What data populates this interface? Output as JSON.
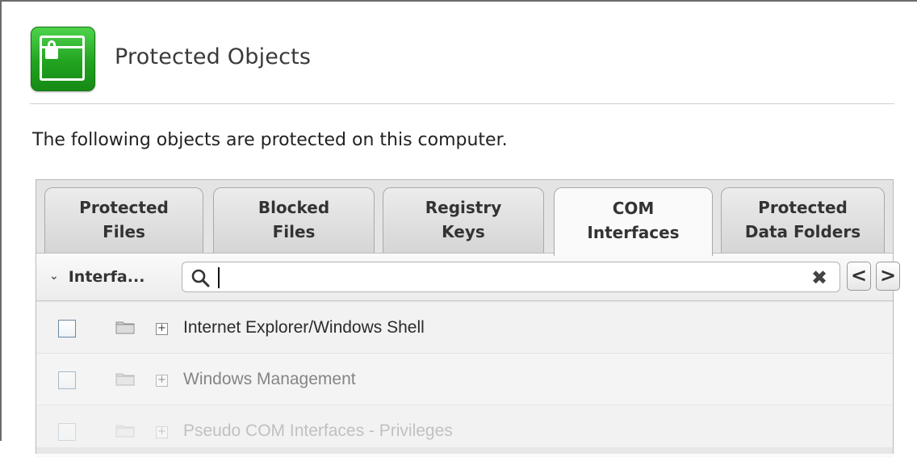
{
  "header": {
    "title": "Protected Objects",
    "icon": "lock-window-icon",
    "accent": "#22a320"
  },
  "description": "The following objects are protected on this computer.",
  "tabs": [
    {
      "label": "Protected\nFiles",
      "active": false
    },
    {
      "label": "Blocked\nFiles",
      "active": false
    },
    {
      "label": "Registry\nKeys",
      "active": false
    },
    {
      "label": "COM\nInterfaces",
      "active": true
    },
    {
      "label": "Protected\nData Folders",
      "active": false
    }
  ],
  "toolbar": {
    "column_select": "Interfa...",
    "search_value": "",
    "clear_icon": "close-icon",
    "prev_label": "<",
    "next_label": ">"
  },
  "rows": [
    {
      "label": "Internet Explorer/Windows Shell",
      "checked": false
    },
    {
      "label": "Windows Management",
      "checked": false
    },
    {
      "label": "Pseudo COM Interfaces - Privileges",
      "checked": false
    }
  ]
}
